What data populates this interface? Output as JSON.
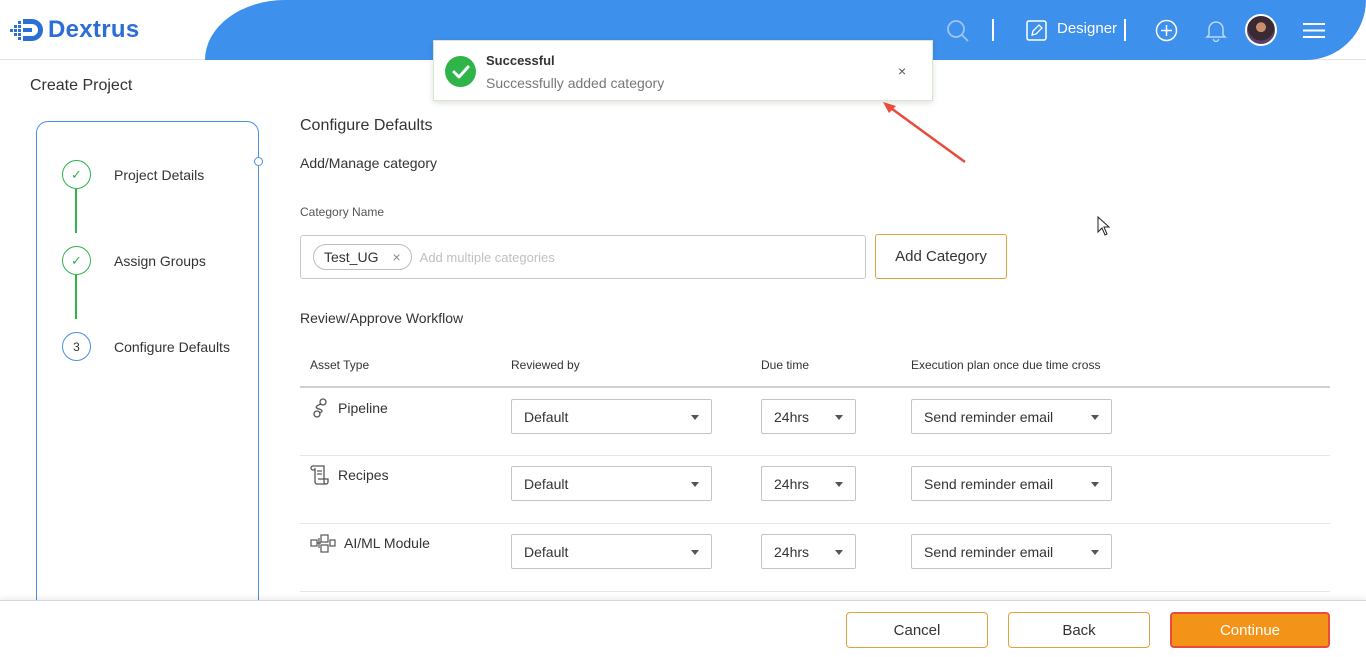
{
  "header": {
    "logo_text": "Dextrus",
    "role_label": "Designer"
  },
  "page": {
    "title": "Create Project"
  },
  "stepper": {
    "steps": [
      {
        "label": "Project Details",
        "status": "completed"
      },
      {
        "label": "Assign Groups",
        "status": "completed"
      },
      {
        "number": "3",
        "label": "Configure Defaults",
        "status": "current"
      }
    ]
  },
  "configure": {
    "title": "Configure Defaults",
    "subtitle": "Add/Manage category",
    "category_label": "Category Name",
    "chip": "Test_UG",
    "chip_remove": "×",
    "placeholder": "Add multiple categories",
    "add_button": "Add Category"
  },
  "workflow": {
    "title": "Review/Approve Workflow",
    "columns": [
      "Asset Type",
      "Reviewed by",
      "Due time",
      "Execution plan once due time cross"
    ],
    "rows": [
      {
        "asset": "Pipeline",
        "icon": "pipeline-icon",
        "reviewed_by": "Default",
        "due_time": "24hrs",
        "plan": "Send reminder email"
      },
      {
        "asset": "Recipes",
        "icon": "recipes-icon",
        "reviewed_by": "Default",
        "due_time": "24hrs",
        "plan": "Send reminder email"
      },
      {
        "asset": "AI/ML Module",
        "icon": "module-icon",
        "reviewed_by": "Default",
        "due_time": "24hrs",
        "plan": "Send reminder email"
      }
    ]
  },
  "footer": {
    "cancel": "Cancel",
    "back": "Back",
    "continue": "Continue"
  },
  "toast": {
    "title": "Successful",
    "message": "Successfully added category",
    "close": "×"
  },
  "colors": {
    "brand_blue": "#3d90ec",
    "success_green": "#2fb44a",
    "accent_orange": "#f39418",
    "annotation_red": "#e94b3c"
  }
}
